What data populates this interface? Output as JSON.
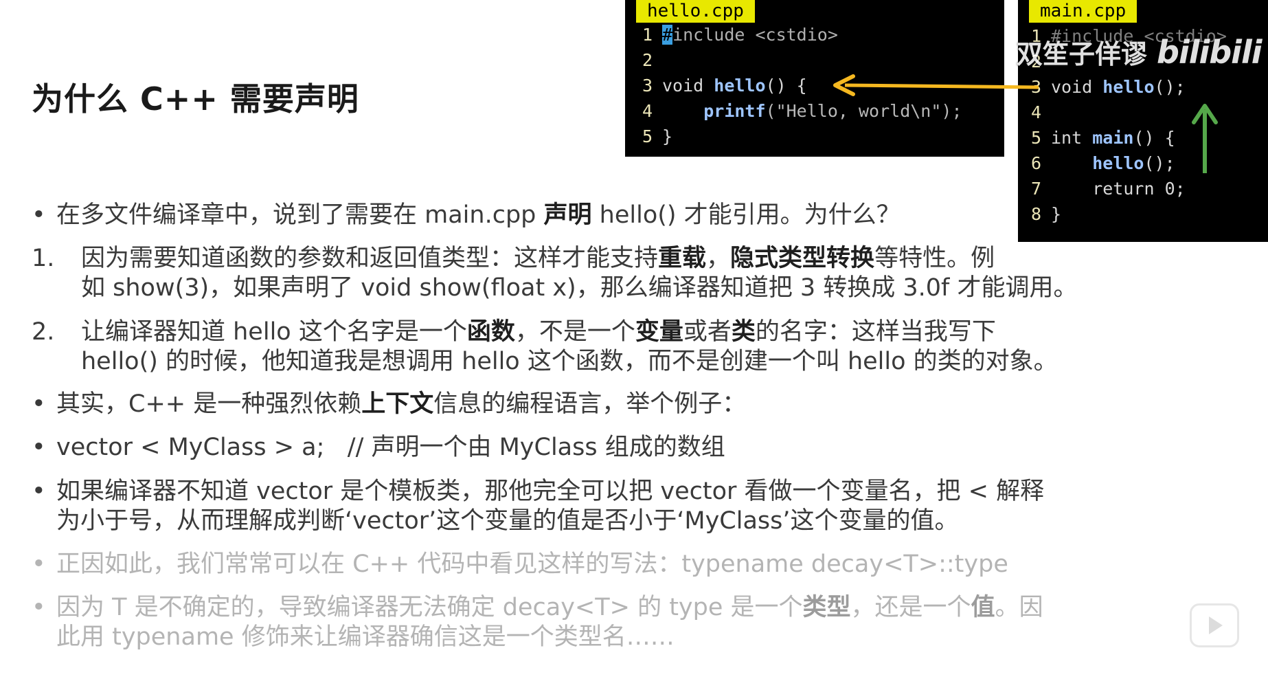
{
  "slide": {
    "title": "为什么 C++ 需要声明"
  },
  "code_hello": {
    "filename": "hello.cpp",
    "lines": [
      {
        "n": "1",
        "a": "#",
        "b": "include <cstdio>"
      },
      {
        "n": "2",
        "a": "",
        "b": ""
      },
      {
        "n": "3",
        "a": "void ",
        "b": "hello",
        "c": "() {"
      },
      {
        "n": "4",
        "a": "    ",
        "b": "printf",
        "c": "(\"Hello, world\\n\");"
      },
      {
        "n": "5",
        "a": "}",
        "b": ""
      }
    ]
  },
  "code_main": {
    "filename": "main.cpp",
    "lines": [
      {
        "n": "1",
        "a": "#include <cstdio>"
      },
      {
        "n": "2",
        "a": ""
      },
      {
        "n": "3",
        "a": "void ",
        "b": "hello",
        "c": "();"
      },
      {
        "n": "4",
        "a": ""
      },
      {
        "n": "5",
        "a": "int ",
        "b": "main",
        "c": "() {"
      },
      {
        "n": "6",
        "a": "    ",
        "b": "hello",
        "c": "();"
      },
      {
        "n": "7",
        "a": "    return 0;"
      },
      {
        "n": "8",
        "a": "}"
      }
    ]
  },
  "watermark": {
    "text": "双笙子佯谬",
    "logo": "bilibili"
  },
  "colors": {
    "arrow_yellow": "#f5b820",
    "arrow_green": "#55a84a",
    "tab_yellow": "#e8e800"
  },
  "points": {
    "p1": {
      "mark": "•",
      "t1": "在多文件编译章中，说到了需要在 main.cpp ",
      "b1": "声明",
      "t2": " hello() 才能引用。为什么？"
    },
    "p2": {
      "mark": "1.",
      "l1a": "因为需要知道函数的参数和返回值类型：这样才能支持",
      "l1b": "重载",
      "l1c": "，",
      "l1d": "隐式类型转换",
      "l1e": "等特性。例",
      "l2": "如 show(3)，如果声明了 void show(float x)，那么编译器知道把 3 转换成 3.0f 才能调用。"
    },
    "p3": {
      "mark": "2.",
      "l1a": "让编译器知道 hello 这个名字是一个",
      "l1b": "函数",
      "l1c": "，不是一个",
      "l1d": "变量",
      "l1e": "或者",
      "l1f": "类",
      "l1g": "的名字：这样当我写下",
      "l2": "hello() 的时候，他知道我是想调用 hello 这个函数，而不是创建一个叫 hello 的类的对象。"
    },
    "p4": {
      "mark": "•",
      "t1": "其实，C++ 是一种强烈依赖",
      "b1": "上下文",
      "t2": "信息的编程语言，举个例子："
    },
    "p5": {
      "mark": "•",
      "t1": "vector < MyClass > a;   // 声明一个由 MyClass 组成的数组"
    },
    "p6": {
      "mark": "•",
      "l1": "如果编译器不知道 vector 是个模板类，那他完全可以把 vector 看做一个变量名，把 < 解释",
      "l2": "为小于号，从而理解成判断‘vector’这个变量的值是否小于‘MyClass’这个变量的值。"
    },
    "p7": {
      "mark": "•",
      "t1": "正因如此，我们常常可以在 C++ 代码中看见这样的写法：typename decay<T>::type"
    },
    "p8": {
      "mark": "•",
      "l1a": "因为 T 是不确定的，导致编译器无法确定 decay<T> 的 type 是一个",
      "l1b": "类型",
      "l1c": "，还是一个",
      "l1d": "值",
      "l1e": "。因",
      "l2": "此用 typename 修饰来让编译器确信这是一个类型名……"
    }
  }
}
